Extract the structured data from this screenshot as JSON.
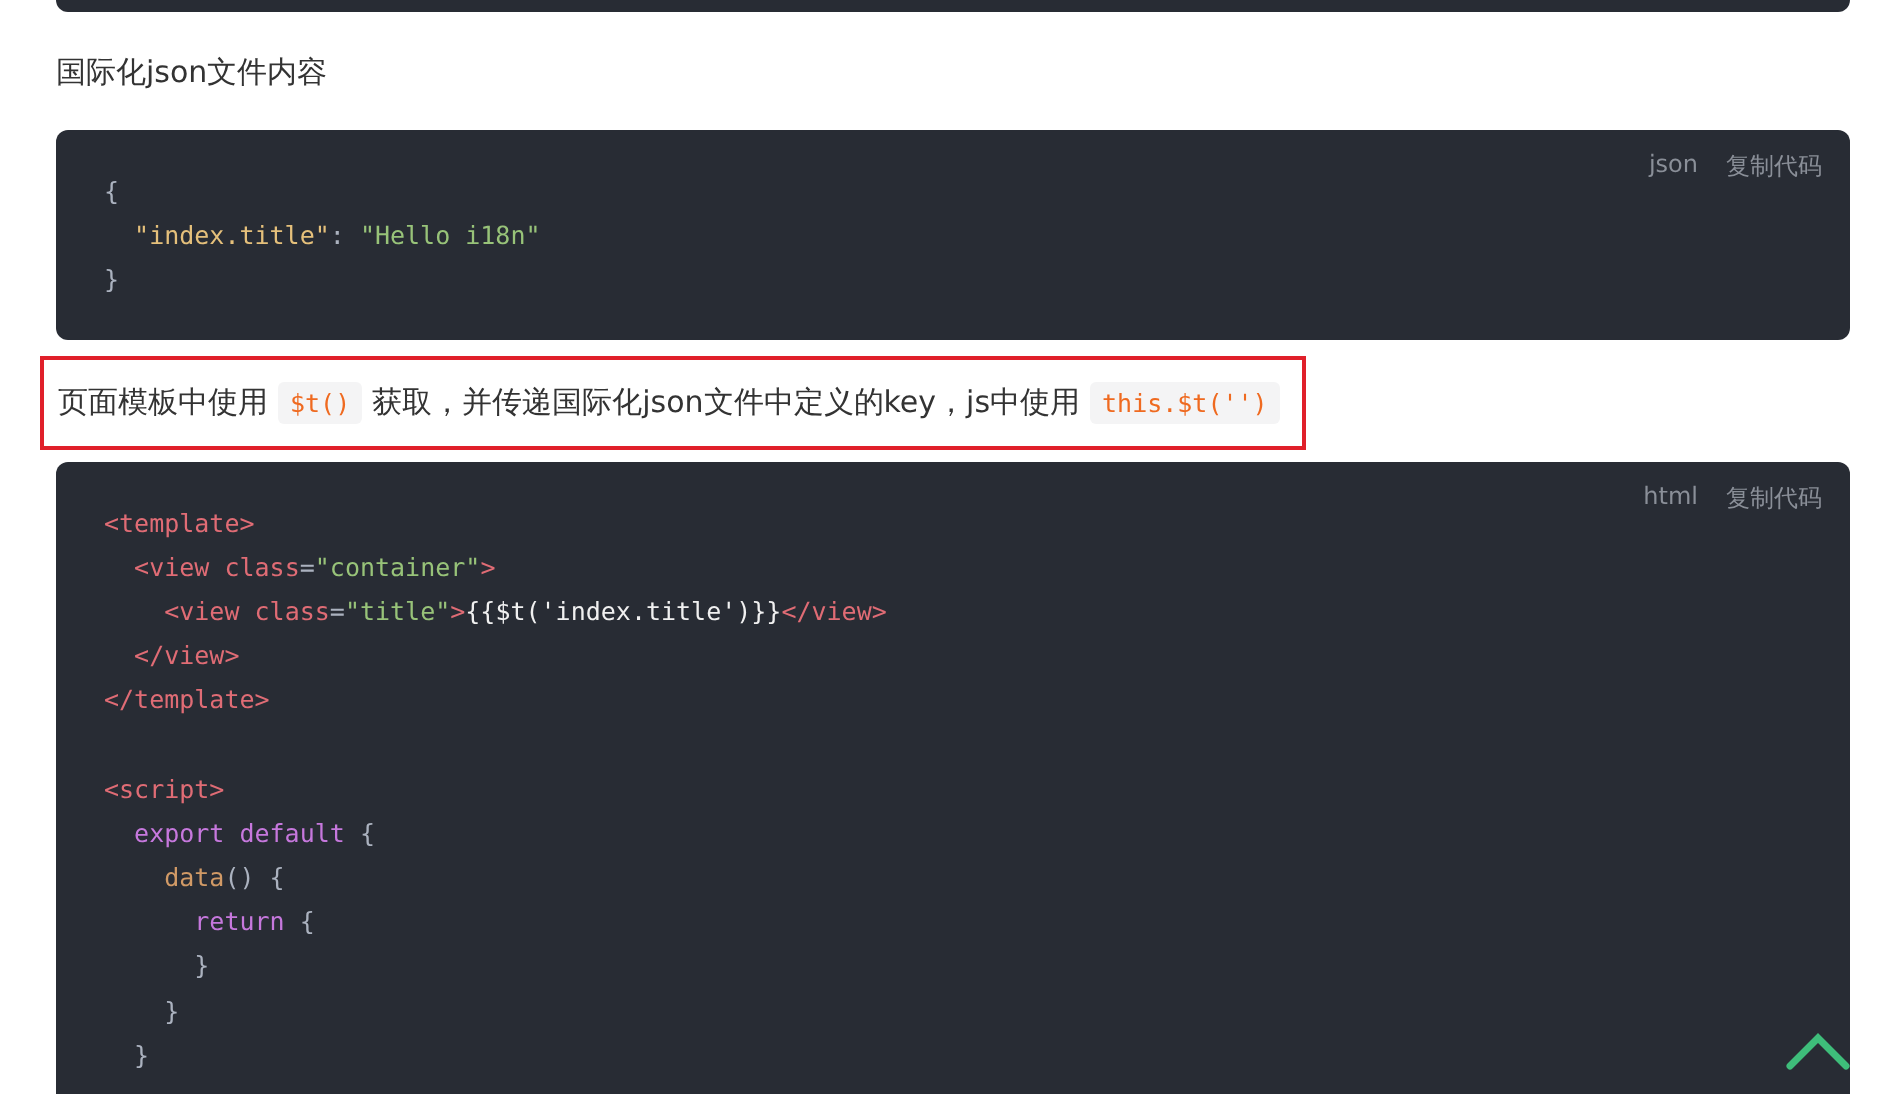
{
  "blocks": [
    {
      "kind": "code_tail"
    },
    {
      "kind": "paragraph",
      "highlighted": false,
      "parts": [
        {
          "kind": "text",
          "text": "国际化json文件内容"
        }
      ]
    },
    {
      "kind": "code",
      "language": "json",
      "copy_label": "复制代码",
      "lines": [
        {
          "tokens": [
            {
              "kind": "punct",
              "text": "{"
            }
          ]
        },
        {
          "tokens": [
            {
              "kind": "key",
              "text": "  \"index.title\""
            },
            {
              "kind": "punct",
              "text": ": "
            },
            {
              "kind": "string",
              "text": "\"Hello i18n\""
            }
          ]
        },
        {
          "tokens": [
            {
              "kind": "punct",
              "text": "}"
            }
          ]
        }
      ]
    },
    {
      "kind": "paragraph",
      "highlighted": true,
      "parts": [
        {
          "kind": "text",
          "text": "页面模板中使用"
        },
        {
          "kind": "code",
          "text": "$t()"
        },
        {
          "kind": "text",
          "text": "获取，并传递国际化json文件中定义的key，js中使用"
        },
        {
          "kind": "code",
          "text": "this.$t('')"
        }
      ]
    },
    {
      "kind": "code",
      "language": "html",
      "copy_label": "复制代码",
      "lines": [
        {
          "tokens": [
            {
              "kind": "tag",
              "text": "<template>"
            }
          ]
        },
        {
          "tokens": [
            {
              "kind": "tag",
              "text": "  <view "
            },
            {
              "kind": "attr",
              "text": "class"
            },
            {
              "kind": "punct",
              "text": "="
            },
            {
              "kind": "string",
              "text": "\"container\""
            },
            {
              "kind": "tag",
              "text": ">"
            }
          ]
        },
        {
          "tokens": [
            {
              "kind": "tag",
              "text": "    <view "
            },
            {
              "kind": "attr",
              "text": "class"
            },
            {
              "kind": "punct",
              "text": "="
            },
            {
              "kind": "string",
              "text": "\"title\""
            },
            {
              "kind": "tag",
              "text": ">"
            },
            {
              "kind": "plain",
              "text": "{{$t('index.title')}}"
            },
            {
              "kind": "tag",
              "text": "</view>"
            }
          ]
        },
        {
          "tokens": [
            {
              "kind": "tag",
              "text": "  </view>"
            }
          ]
        },
        {
          "tokens": [
            {
              "kind": "tag",
              "text": "</template>"
            }
          ]
        },
        {
          "gap_before": true,
          "tokens": [
            {
              "kind": "tag",
              "text": "<script>"
            }
          ]
        },
        {
          "tokens": [
            {
              "kind": "keyword",
              "text": "  export default"
            },
            {
              "kind": "punct",
              "text": " {"
            }
          ]
        },
        {
          "tokens": [
            {
              "kind": "function",
              "text": "    data"
            },
            {
              "kind": "punct",
              "text": "() {"
            }
          ]
        },
        {
          "tokens": [
            {
              "kind": "keyword",
              "text": "      return"
            },
            {
              "kind": "punct",
              "text": " {"
            }
          ]
        },
        {
          "tokens": [
            {
              "kind": "punct",
              "text": "      }"
            }
          ]
        },
        {
          "tokens": [
            {
              "kind": "punct",
              "text": "    }"
            }
          ]
        },
        {
          "tokens": [
            {
              "kind": "punct",
              "text": "  }"
            }
          ]
        }
      ]
    }
  ]
}
